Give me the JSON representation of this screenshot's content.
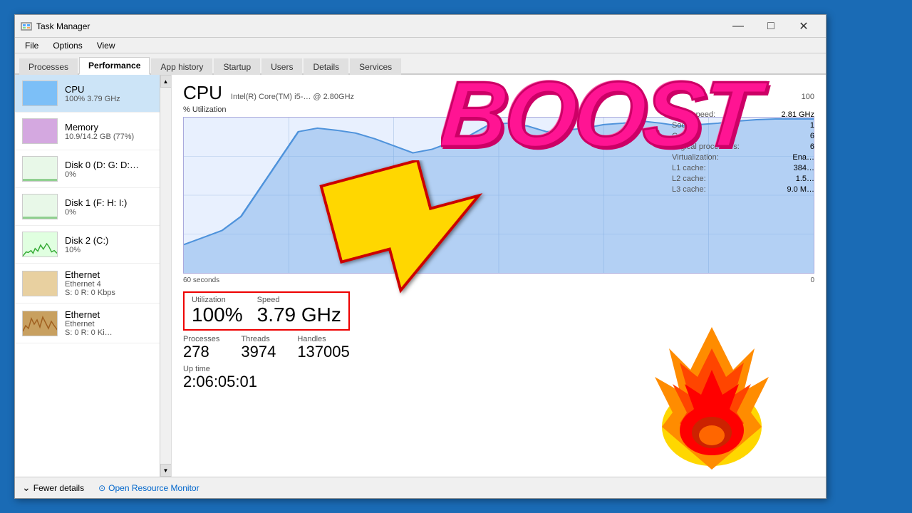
{
  "window": {
    "title": "Task Manager",
    "title_icon": "⚙"
  },
  "title_controls": {
    "minimize": "—",
    "maximize": "□",
    "close": "✕"
  },
  "menu": {
    "items": [
      "File",
      "Options",
      "View"
    ]
  },
  "tabs": [
    {
      "label": "Processes",
      "active": false
    },
    {
      "label": "Performance",
      "active": true
    },
    {
      "label": "App history",
      "active": false
    },
    {
      "label": "Startup",
      "active": false
    },
    {
      "label": "Users",
      "active": false
    },
    {
      "label": "Details",
      "active": false
    },
    {
      "label": "Services",
      "active": false
    }
  ],
  "sidebar": {
    "items": [
      {
        "name": "CPU",
        "value": "100%  3.79 GHz",
        "type": "cpu",
        "active": true
      },
      {
        "name": "Memory",
        "value": "10.9/14.2 GB (77%)",
        "type": "memory",
        "active": false
      },
      {
        "name": "Disk 0 (D: G: D:…",
        "value": "0%",
        "type": "disk0",
        "active": false
      },
      {
        "name": "Disk 1 (F: H: I:)",
        "value": "0%",
        "type": "disk1",
        "active": false
      },
      {
        "name": "Disk 2 (C:)",
        "value": "10%",
        "type": "disk2",
        "active": false
      },
      {
        "name": "Ethernet",
        "subname": "Ethernet 4",
        "value": "S: 0  R: 0 Kbps",
        "type": "ethernet",
        "active": false
      },
      {
        "name": "Ethernet",
        "subname": "Ethernet",
        "value": "S: 0  R: 0 Ki…",
        "type": "ethernet2",
        "active": false
      }
    ]
  },
  "cpu_panel": {
    "title": "CPU",
    "subtitle": "Intel(R) Core(TM) i5-…  @ 2.80GHz",
    "utilization_label": "% Utilization",
    "max_label": "100",
    "min_label": "0",
    "time_label": "60 seconds",
    "utilization": {
      "label": "Utilization",
      "value": "100%"
    },
    "speed": {
      "label": "Speed",
      "value": "3.79 GHz"
    },
    "processes": {
      "label": "Processes",
      "value": "278"
    },
    "threads": {
      "label": "Threads",
      "value": "3974"
    },
    "handles": {
      "label": "Handles",
      "value": "137005"
    },
    "uptime": {
      "label": "Up time",
      "value": "2:06:05:01"
    },
    "base_speed": {
      "label": "Base speed:",
      "value": "2.81 GHz"
    },
    "sockets": {
      "label": "Sockets:",
      "value": "1"
    },
    "cores": {
      "label": "Cores:",
      "value": "6"
    },
    "logical_processors": {
      "label": "Logical processors:",
      "value": "6"
    },
    "virtualization": {
      "label": "Virtualization:",
      "value": "Ena…"
    },
    "l1_cache": {
      "label": "L1 cache:",
      "value": "384…"
    },
    "l2_cache": {
      "label": "L2 cache:",
      "value": "1.5…"
    },
    "l3_cache": {
      "label": "L3 cache:",
      "value": "9.0 M…"
    }
  },
  "bottom": {
    "fewer_details": "Fewer details",
    "open_resource_monitor": "Open Resource Monitor"
  },
  "overlay": {
    "boost_text": "BOOST"
  }
}
